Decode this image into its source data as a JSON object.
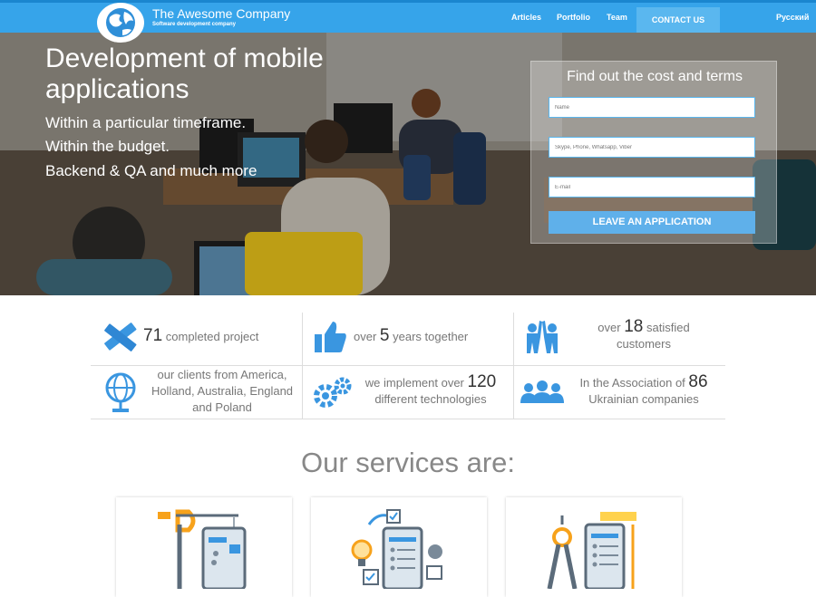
{
  "header": {
    "brand_name": "The Awesome Company",
    "brand_tagline": "Software development company",
    "nav": [
      "Articles",
      "Portfolio",
      "Team"
    ],
    "contact_label": "CONTACT US",
    "language": "Русский"
  },
  "hero": {
    "title": "Development of mobile applications",
    "lines": [
      "Within a particular timeframe.",
      "Within the budget.",
      "Backend & QA and much more"
    ]
  },
  "form": {
    "title": "Find out the cost and terms",
    "name_placeholder": "Name",
    "contact_placeholder": "Skype, Phone, Whatsapp, Viber",
    "email_placeholder": "E-mail",
    "submit_label": "LEAVE AN APPLICATION"
  },
  "stats": {
    "projects": {
      "num": "71",
      "text": "completed project"
    },
    "years": {
      "pre": "over",
      "num": "5",
      "text": "years together"
    },
    "customers": {
      "pre": "over",
      "num": "18",
      "text": "satisfied",
      "text2": "customers"
    },
    "clients": {
      "line1": "our clients from America,",
      "line2": "Holland, Australia, England",
      "line3": "and Poland"
    },
    "tech": {
      "pre": "we implement over",
      "num": "120",
      "text2": "different technologies"
    },
    "association": {
      "pre": "In the Association of",
      "num": "86",
      "text2": "Ukrainian companies"
    }
  },
  "services": {
    "title": "Our services are:"
  },
  "colors": {
    "accent": "#36a4ea",
    "icon_blue": "#3a96e0",
    "orange": "#f7a21b"
  }
}
